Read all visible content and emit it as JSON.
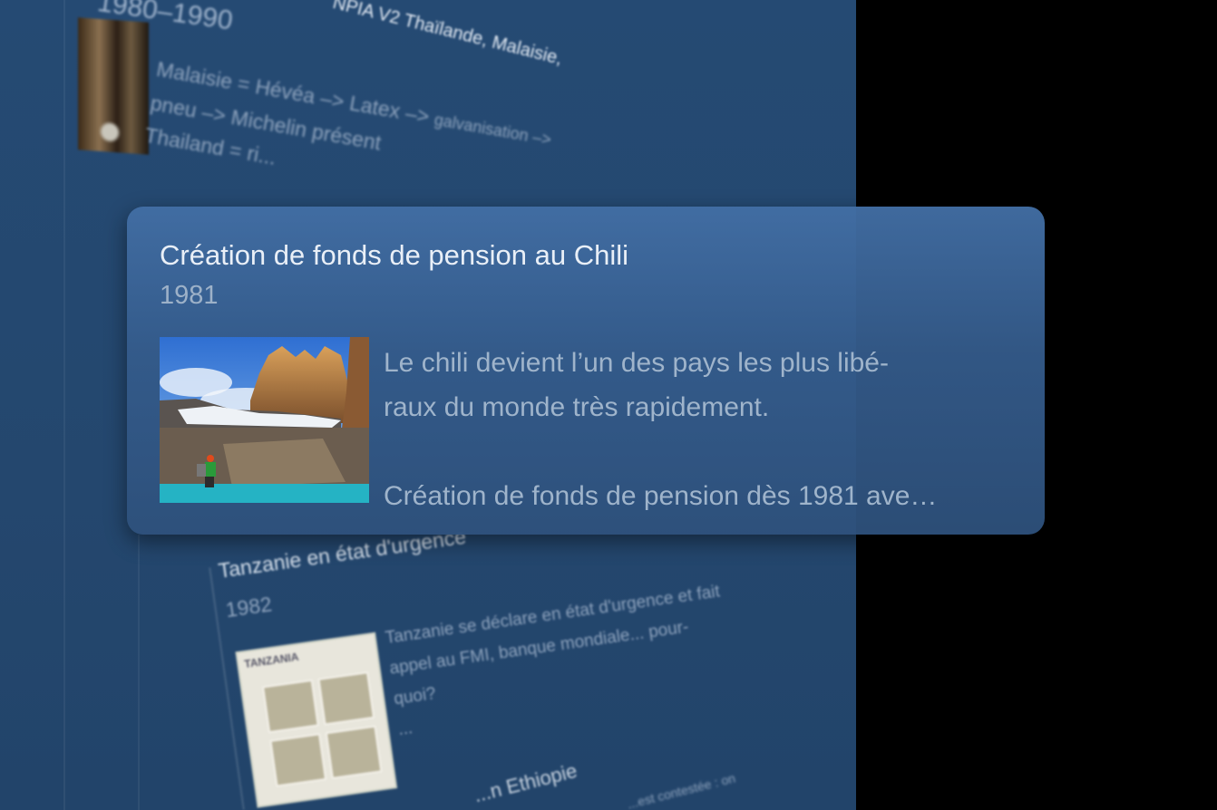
{
  "background_entries": {
    "top": {
      "year": "1980–1990",
      "title": "NPIA V2 Thaïlande, Malaisie,",
      "desc_line1": "Malaisie = Hévéa –> Latex –> ",
      "desc_line1_small": "galvanisation –>",
      "desc_line2": "pneu –> Michelin présent",
      "desc_line3": "Thailand = ri..."
    },
    "tanzania": {
      "title": "Tanzanie en état d'urgence",
      "year": "1982",
      "stamp_header": "TANZANIA",
      "desc_lines": [
        "Tanzanie se déclare en état d'urgence et fait",
        "appel au FMI, banque mondiale... pour-",
        "quoi?",
        "..."
      ]
    },
    "bottom": {
      "title": "...n Ethiopie",
      "note": "...est contestée : on"
    }
  },
  "highlighted_card": {
    "title": "Création de fonds de pension au Chili",
    "year": "1981",
    "image_icon": "torres-del-paine-photo",
    "desc_line1": "Le chili devient l’un des pays les plus libé-",
    "desc_line2": "raux du monde très rapidement.",
    "desc_line3": "Création de fonds de pension dès 1981 ave…"
  },
  "colors": {
    "panel": "#24476e",
    "card": "#3f6aa0",
    "outside": "#000000"
  }
}
